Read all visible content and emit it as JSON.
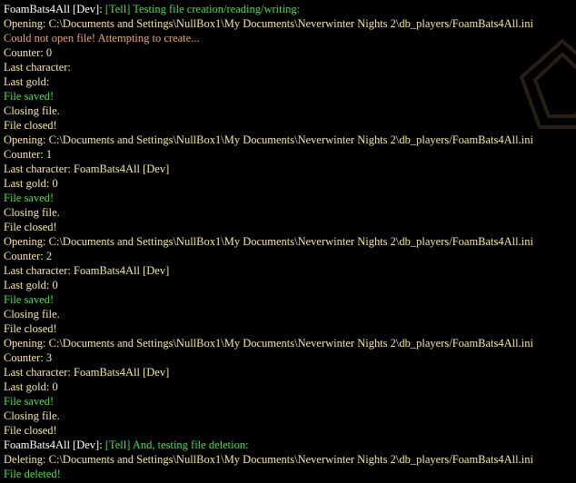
{
  "colors": {
    "background": "#000000",
    "speaker": "#ffffff",
    "tell": "#3ee043",
    "info": "#f5e88a",
    "warning": "#f0a060",
    "success": "#3ee043"
  },
  "chat": {
    "lines": [
      {
        "type": "tell",
        "speaker": "FoamBats4All [Dev]: ",
        "message": "[Tell] Testing file creation/reading/writing:"
      },
      {
        "type": "info",
        "text": "Opening: C:\\Documents and Settings\\NullBox1\\My Documents\\Neverwinter Nights 2\\db_players/FoamBats4All.ini"
      },
      {
        "type": "warning",
        "text": "Could not open file! Attempting to create..."
      },
      {
        "type": "info",
        "text": "Counter: 0"
      },
      {
        "type": "info",
        "text": "Last character:"
      },
      {
        "type": "info",
        "text": "Last gold:"
      },
      {
        "type": "success",
        "text": "File saved!"
      },
      {
        "type": "info",
        "text": "Closing file."
      },
      {
        "type": "info",
        "text": "File closed!"
      },
      {
        "type": "info",
        "text": "Opening: C:\\Documents and Settings\\NullBox1\\My Documents\\Neverwinter Nights 2\\db_players/FoamBats4All.ini"
      },
      {
        "type": "info",
        "text": "Counter: 1"
      },
      {
        "type": "info",
        "text": "Last character: FoamBats4All [Dev]"
      },
      {
        "type": "info",
        "text": "Last gold: 0"
      },
      {
        "type": "success",
        "text": "File saved!"
      },
      {
        "type": "info",
        "text": "Closing file."
      },
      {
        "type": "info",
        "text": "File closed!"
      },
      {
        "type": "info",
        "text": "Opening: C:\\Documents and Settings\\NullBox1\\My Documents\\Neverwinter Nights 2\\db_players/FoamBats4All.ini"
      },
      {
        "type": "info",
        "text": "Counter: 2"
      },
      {
        "type": "info",
        "text": "Last character: FoamBats4All [Dev]"
      },
      {
        "type": "info",
        "text": "Last gold: 0"
      },
      {
        "type": "success",
        "text": "File saved!"
      },
      {
        "type": "info",
        "text": "Closing file."
      },
      {
        "type": "info",
        "text": "File closed!"
      },
      {
        "type": "info",
        "text": "Opening: C:\\Documents and Settings\\NullBox1\\My Documents\\Neverwinter Nights 2\\db_players/FoamBats4All.ini"
      },
      {
        "type": "info",
        "text": "Counter: 3"
      },
      {
        "type": "info",
        "text": "Last character: FoamBats4All [Dev]"
      },
      {
        "type": "info",
        "text": "Last gold: 0"
      },
      {
        "type": "success",
        "text": "File saved!"
      },
      {
        "type": "info",
        "text": "Closing file."
      },
      {
        "type": "info",
        "text": "File closed!"
      },
      {
        "type": "tell",
        "speaker": "FoamBats4All [Dev]: ",
        "message": "[Tell] And, testing file deletion:"
      },
      {
        "type": "info",
        "text": "Deleting: C:\\Documents and Settings\\NullBox1\\My Documents\\Neverwinter Nights 2\\db_players/FoamBats4All.ini"
      },
      {
        "type": "success",
        "text": "File deleted!"
      }
    ]
  }
}
